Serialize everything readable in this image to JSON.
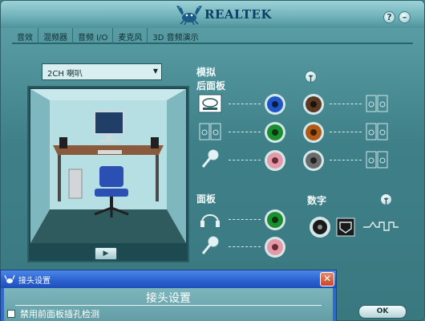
{
  "header": {
    "brand": "REALTEK",
    "help_btn": "?",
    "minimize_btn": "–"
  },
  "tabs": [
    "音效",
    "混频器",
    "音频 I/O",
    "麦克风",
    "3D 音频演示"
  ],
  "left": {
    "speaker_config": "2CH 喇叭",
    "play_btn": "▶"
  },
  "right": {
    "analog_label": "模拟",
    "back_panel_label": "后面板",
    "front_panel_label": "面板",
    "digital_label": "数字"
  },
  "jacks": {
    "back_left": [
      "#1f57c9",
      "#1a8f2e",
      "#e39aa8"
    ],
    "back_right": [
      "#5a3a24",
      "#b05a18",
      "#6b6b6b"
    ],
    "front": [
      "#1a8f2e",
      "#e39aa8"
    ]
  },
  "dialog": {
    "title": "接头设置",
    "close_btn": "✕",
    "heading": "接头设置",
    "checkbox_label": "禁用前面板插孔检测",
    "checkbox_checked": false
  },
  "footer": {
    "ok_label": "OK"
  }
}
